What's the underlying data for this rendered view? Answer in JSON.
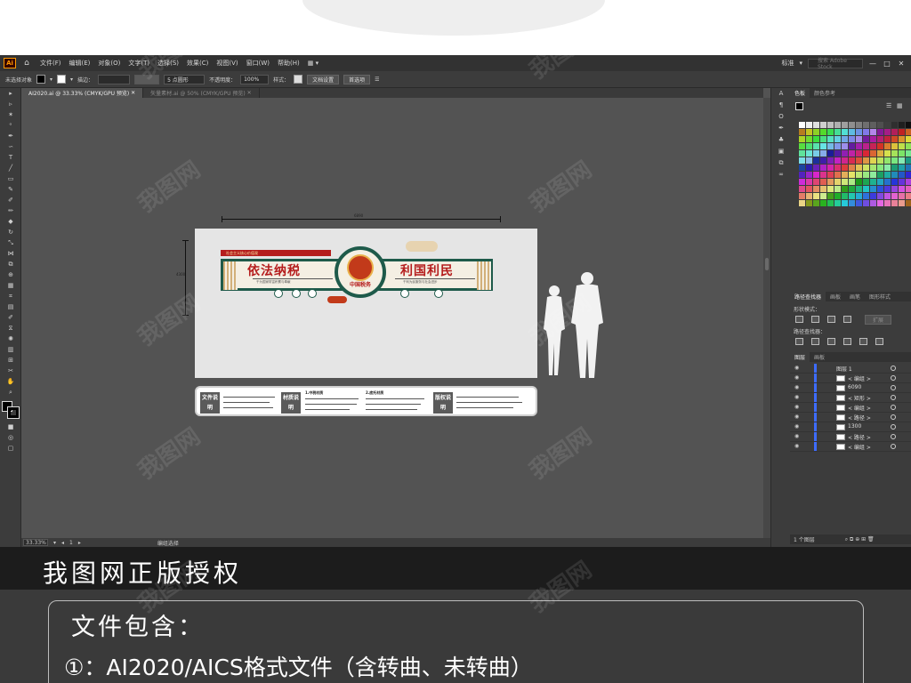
{
  "app": {
    "logo": "Ai",
    "menu": [
      "文件(F)",
      "编辑(E)",
      "对象(O)",
      "文字(T)",
      "选择(S)",
      "效果(C)",
      "视图(V)",
      "窗口(W)",
      "帮助(H)"
    ],
    "workspace": "标准",
    "stock_search_placeholder": "搜索 Adobe Stock"
  },
  "controlbar": {
    "selection": "未选择对象",
    "stroke_label": "描边：",
    "brush": "5 点圆形",
    "opacity_label": "不透明度：",
    "opacity_value": "100%",
    "style_label": "样式：",
    "doc_setup": "文档设置",
    "preferences": "首选项"
  },
  "tabs": [
    {
      "label": "AI2020.ai @ 33.33% (CMYK/GPU 预览)"
    },
    {
      "label": "矢量素材.ai @ 50% (CMYK/GPU 预览)"
    }
  ],
  "status": {
    "zoom": "33.33%",
    "page": "1",
    "tool": "编组选择"
  },
  "artwork": {
    "width_dim": "6890",
    "height_dim": "4300",
    "banner_strip": "社会主义核心价值观",
    "left_title": "依法纳税",
    "right_title": "利国利民",
    "emblem_text": "中国税务",
    "left_sub": "干为国家财富积累与奉献",
    "right_sub": "干利为民服务与社会进步",
    "info_labels": [
      "文件说明",
      "材质说明",
      "版权说明"
    ],
    "info_titles": [
      "1.中税材质",
      "2.底托材质"
    ]
  },
  "panels": {
    "swatch_tabs": [
      "色板",
      "颜色参考"
    ],
    "pathfinder_tabs": [
      "路径查找器",
      "画板",
      "画笔",
      "图形样式"
    ],
    "shape_mode_label": "形状模式：",
    "pathfinder_label": "路径查找器：",
    "expand_btn": "扩展",
    "layers_tabs": [
      "图层",
      "画板"
    ],
    "layers": [
      {
        "name": "图层 1"
      },
      {
        "name": "< 编组 >"
      },
      {
        "name": "6090"
      },
      {
        "name": "< 矩形 >"
      },
      {
        "name": "< 编组 >"
      },
      {
        "name": "< 路径 >"
      },
      {
        "name": "1300"
      },
      {
        "name": "< 路径 >"
      },
      {
        "name": "< 编组 >"
      }
    ],
    "layers_footer": "1 个图层"
  },
  "promo": {
    "title": "我图网正版授权",
    "contains_title": "文件包含：",
    "line1": "①：AI2020/AICS格式文件（含转曲、未转曲）"
  },
  "watermark": "我图网"
}
